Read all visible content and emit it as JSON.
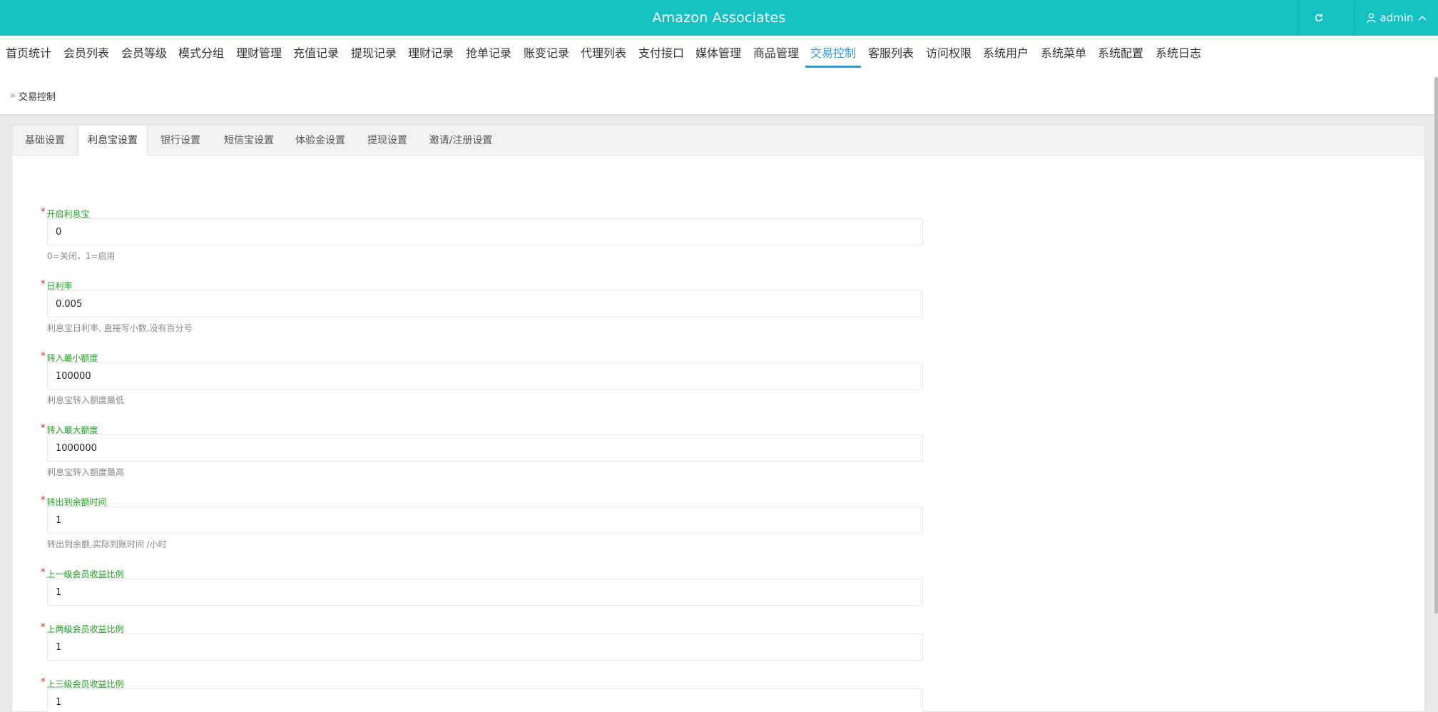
{
  "header": {
    "title": "Amazon Associates",
    "user": "admin"
  },
  "nav": [
    {
      "label": "首页统计"
    },
    {
      "label": "会员列表"
    },
    {
      "label": "会员等级"
    },
    {
      "label": "模式分组"
    },
    {
      "label": "理财管理"
    },
    {
      "label": "充值记录"
    },
    {
      "label": "提现记录"
    },
    {
      "label": "理财记录"
    },
    {
      "label": "抢单记录"
    },
    {
      "label": "账变记录"
    },
    {
      "label": "代理列表"
    },
    {
      "label": "支付接口"
    },
    {
      "label": "媒体管理"
    },
    {
      "label": "商品管理"
    },
    {
      "label": "交易控制"
    },
    {
      "label": "客服列表"
    },
    {
      "label": "访问权限"
    },
    {
      "label": "系统用户"
    },
    {
      "label": "系统菜单"
    },
    {
      "label": "系统配置"
    },
    {
      "label": "系统日志"
    }
  ],
  "breadcrumb": "交易控制",
  "tabs": [
    {
      "label": "基础设置"
    },
    {
      "label": "利息宝设置"
    },
    {
      "label": "银行设置"
    },
    {
      "label": "短信宝设置"
    },
    {
      "label": "体验金设置"
    },
    {
      "label": "提现设置"
    },
    {
      "label": "邀请/注册设置"
    }
  ],
  "form": [
    {
      "label": "开启利息宝",
      "value": "0",
      "hint": "0=关闭，1=启用"
    },
    {
      "label": "日利率",
      "value": "0.005",
      "hint": "利息宝日利率, 直接写小数,没有百分号"
    },
    {
      "label": "转入最小额度",
      "value": "100000",
      "hint": "利息宝转入额度最低"
    },
    {
      "label": "转入最大额度",
      "value": "1000000",
      "hint": "利息宝转入额度最高"
    },
    {
      "label": "转出到余额时间",
      "value": "1",
      "hint": "转出到余额,实际到账时间 /小时"
    },
    {
      "label": "上一级会员收益比例",
      "value": "1",
      "hint": ""
    },
    {
      "label": "上两级会员收益比例",
      "value": "1",
      "hint": ""
    },
    {
      "label": "上三级会员收益比例",
      "value": "1",
      "hint": ""
    }
  ],
  "colors": {
    "header": "#14c2c3",
    "active": "#2f9bd6",
    "label": "#1e9e1e",
    "required": "#e02020"
  },
  "active_nav": "交易控制",
  "active_tab": "利息宝设置"
}
